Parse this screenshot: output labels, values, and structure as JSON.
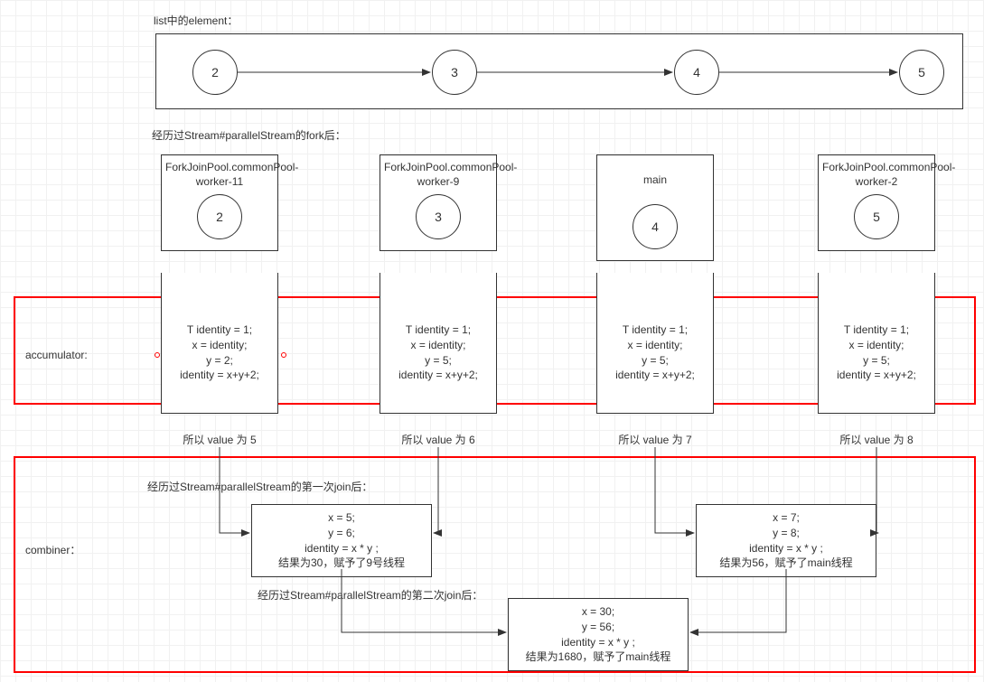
{
  "labels": {
    "listElements": "list中的element：",
    "afterFork": "经历过Stream#parallelStream的fork后：",
    "accumulator": "accumulator:",
    "combiner": "combiner：",
    "join1": "经历过Stream#parallelStream的第一次join后：",
    "join2": "经历过Stream#parallelStream的第二次join后："
  },
  "elements": [
    "2",
    "3",
    "4",
    "5"
  ],
  "threads": [
    {
      "title": "ForkJoinPool.commonPool-worker-11",
      "value": "2",
      "acc": {
        "l1": "T identity = 1;",
        "l2": "x = identity;",
        "l3": "y = 2;",
        "l4": "identity = x+y+2;"
      },
      "result": "所以 value 为 5"
    },
    {
      "title": "ForkJoinPool.commonPool-worker-9",
      "value": "3",
      "acc": {
        "l1": "T identity = 1;",
        "l2": "x = identity;",
        "l3": "y = 5;",
        "l4": "identity = x+y+2;"
      },
      "result": "所以 value 为 6"
    },
    {
      "title": "main",
      "value": "4",
      "acc": {
        "l1": "T identity = 1;",
        "l2": "x = identity;",
        "l3": "y = 5;",
        "l4": "identity = x+y+2;"
      },
      "result": "所以 value 为 7"
    },
    {
      "title": "ForkJoinPool.commonPool-worker-2",
      "value": "5",
      "acc": {
        "l1": "T identity = 1;",
        "l2": "x = identity;",
        "l3": "y = 5;",
        "l4": "identity = x+y+2;"
      },
      "result": "所以 value 为 8"
    }
  ],
  "joins": [
    {
      "l1": "x = 5;",
      "l2": "y = 6;",
      "l3": "identity = x * y ;",
      "l4": "结果为30，赋予了9号线程"
    },
    {
      "l1": "x = 7;",
      "l2": "y = 8;",
      "l3": "identity = x * y ;",
      "l4": "结果为56，赋予了main线程"
    },
    {
      "l1": "x = 30;",
      "l2": "y = 56;",
      "l3": "identity = x * y ;",
      "l4": "结果为1680，赋予了main线程"
    }
  ]
}
